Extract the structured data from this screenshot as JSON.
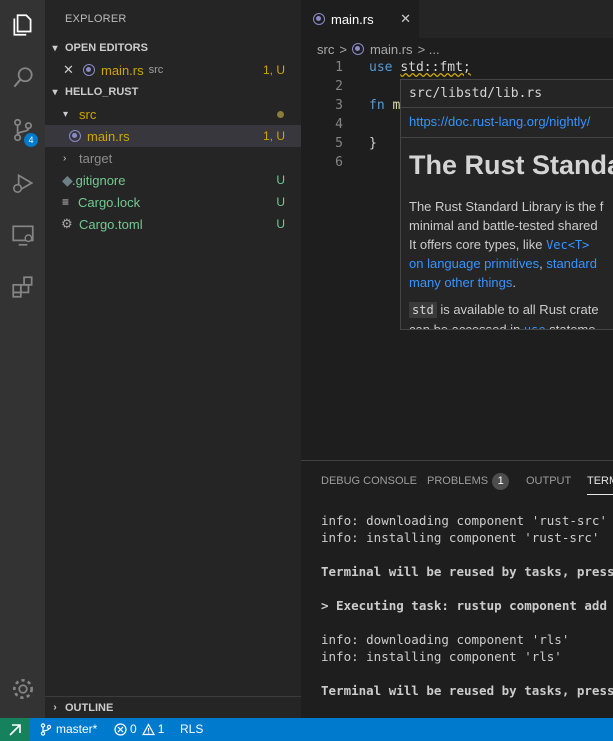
{
  "activity_bar": {
    "scm_badge": "4"
  },
  "sidebar": {
    "title": "EXPLORER",
    "open_editors": {
      "header": "OPEN EDITORS",
      "items": [
        {
          "name": "main.rs",
          "folder": "src",
          "status": "1, U"
        }
      ]
    },
    "project": {
      "header": "HELLO_RUST",
      "tree": [
        {
          "name": "src",
          "status": ""
        },
        {
          "name": "main.rs",
          "status": "1, U"
        },
        {
          "name": "target",
          "status": ""
        },
        {
          "name": ".gitignore",
          "status": "U"
        },
        {
          "name": "Cargo.lock",
          "status": "U"
        },
        {
          "name": "Cargo.toml",
          "status": "U"
        }
      ]
    },
    "outline_header": "OUTLINE"
  },
  "editor": {
    "tab": {
      "label": "main.rs",
      "close": "✕"
    },
    "breadcrumb": {
      "folder": "src",
      "sep": ">",
      "file": "main.rs",
      "more": "> ..."
    },
    "lines": [
      "1",
      "2",
      "3",
      "4",
      "5",
      "6"
    ],
    "code": {
      "line1_kw": "use",
      "line1_rest": "std::fmt;",
      "line3_kw": "fn",
      "line3_fn": "m",
      "line5": "}"
    }
  },
  "hover": {
    "signature": "src/libstd/lib.rs",
    "link": "https://doc.rust-lang.org/nightly/",
    "heading": "The Rust Standa",
    "p1_line1": "The Rust Standard Library is the f",
    "p1_line2": "minimal and battle-tested shared",
    "p1_line3_text": "It offers core types, like",
    "p1_line3_code": "Vec<T>",
    "p1_line4_link1": "on language primitives",
    "p1_line4_sep": ",",
    "p1_line4_link2": "standard",
    "p1_line5_link": "many other things",
    "p1_line5_end": ".",
    "p2_code": "std",
    "p2_text": "is available to all Rust crate",
    "p2_line2": "can be accessed in",
    "p2_line2_code": "use",
    "p2_line2_end": "stateme"
  },
  "panel": {
    "tabs": {
      "debug": "DEBUG CONSOLE",
      "problems": "PROBLEMS",
      "problems_count": "1",
      "output": "OUTPUT",
      "terminal": "TERMINAL"
    },
    "terminal_lines": [
      "info: downloading component 'rust-src'",
      "info: installing component 'rust-src'",
      "",
      "Terminal will be reused by tasks, press an",
      "",
      "> Executing task: rustup component add rls",
      "",
      "info: downloading component 'rls'",
      "info: installing component 'rls'",
      "",
      "Terminal will be reused by tasks, press an"
    ]
  },
  "status_bar": {
    "branch": "master*",
    "errors": "0",
    "warnings": "1",
    "rls": "RLS"
  },
  "colors": {
    "accent": "#007acc",
    "remote": "#16825d",
    "git_untracked": "#73c991",
    "warning": "#cca700",
    "link": "#3794ff"
  }
}
